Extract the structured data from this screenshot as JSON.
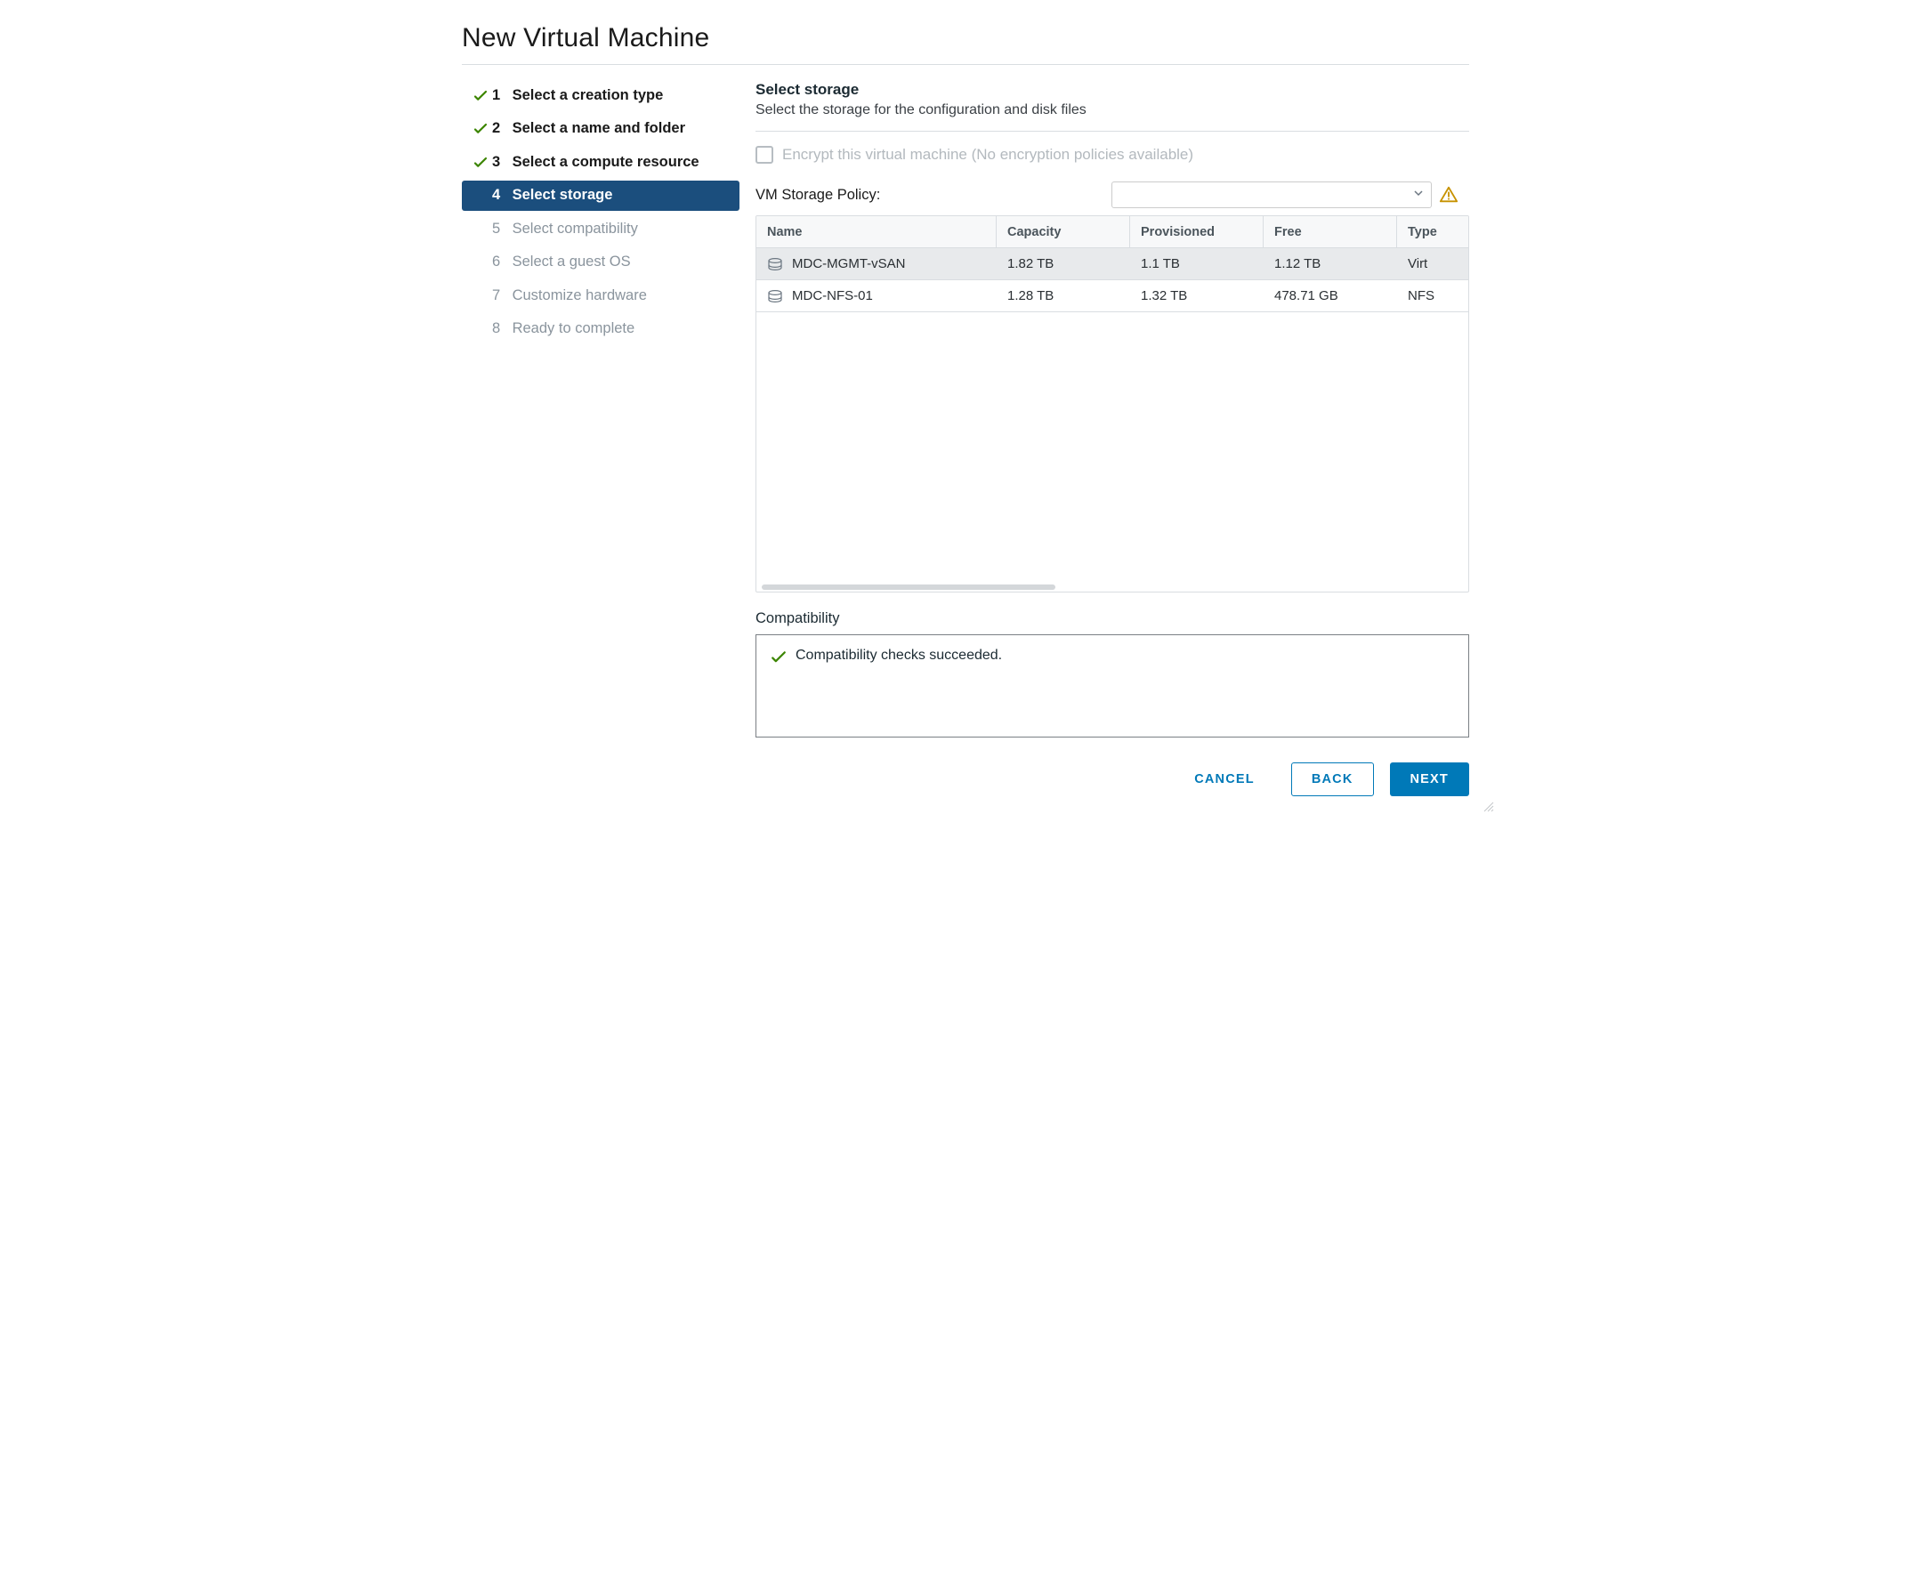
{
  "wizard_title": "New Virtual Machine",
  "nav": {
    "items": [
      {
        "num": "1",
        "label": "Select a creation type",
        "state": "done"
      },
      {
        "num": "2",
        "label": "Select a name and folder",
        "state": "done"
      },
      {
        "num": "3",
        "label": "Select a compute resource",
        "state": "done"
      },
      {
        "num": "4",
        "label": "Select storage",
        "state": "active"
      },
      {
        "num": "5",
        "label": "Select compatibility",
        "state": "future"
      },
      {
        "num": "6",
        "label": "Select a guest OS",
        "state": "future"
      },
      {
        "num": "7",
        "label": "Customize hardware",
        "state": "future"
      },
      {
        "num": "8",
        "label": "Ready to complete",
        "state": "future"
      }
    ]
  },
  "step": {
    "title": "Select storage",
    "subtitle": "Select the storage for the configuration and disk files"
  },
  "encrypt": {
    "label": "Encrypt this virtual machine (No encryption policies available)",
    "checked": false,
    "disabled": true
  },
  "policy": {
    "label": "VM Storage Policy:",
    "selected": "",
    "warn": true
  },
  "table": {
    "headers": {
      "name": "Name",
      "capacity": "Capacity",
      "provisioned": "Provisioned",
      "free": "Free",
      "type": "Type"
    },
    "rows": [
      {
        "name": "MDC-MGMT-vSAN",
        "capacity": "1.82 TB",
        "provisioned": "1.1 TB",
        "free": "1.12 TB",
        "type": "Virt",
        "selected": true
      },
      {
        "name": "MDC-NFS-01",
        "capacity": "1.28 TB",
        "provisioned": "1.32 TB",
        "free": "478.71 GB",
        "type": "NFS",
        "selected": false
      }
    ]
  },
  "compat": {
    "title": "Compatibility",
    "message": "Compatibility checks succeeded."
  },
  "footer": {
    "cancel": "CANCEL",
    "back": "BACK",
    "next": "NEXT"
  },
  "colors": {
    "primary": "#0079b8",
    "nav_active_bg": "#1b4e7d",
    "success": "#3c8500",
    "warning": "#c79200"
  }
}
